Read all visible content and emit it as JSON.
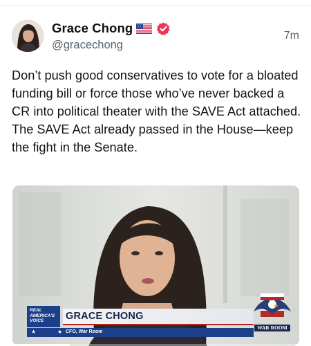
{
  "post": {
    "display_name": "Grace Chong",
    "flag": "us-flag-icon",
    "verified": "verified-badge-icon",
    "handle": "@gracechong",
    "timestamp": "7m",
    "text": "Don’t push good conservatives to vote for a bloated funding bill or force those who’ve never backed a CR into political theater with the SAVE Act attached. The SAVE Act already passed in the House—keep the fight in the Senate."
  },
  "media": {
    "network_logo": "REAL AMERICA'S VOICE",
    "lower_third_name": "GRACE CHONG",
    "lower_third_role": "CFO, War Room",
    "show_logo": "WAR ROOM",
    "playback_progress": 0.2
  },
  "colors": {
    "verified": "#e8375a",
    "rav_blue": "#1c3f8a",
    "accent_red": "#b3261e"
  }
}
